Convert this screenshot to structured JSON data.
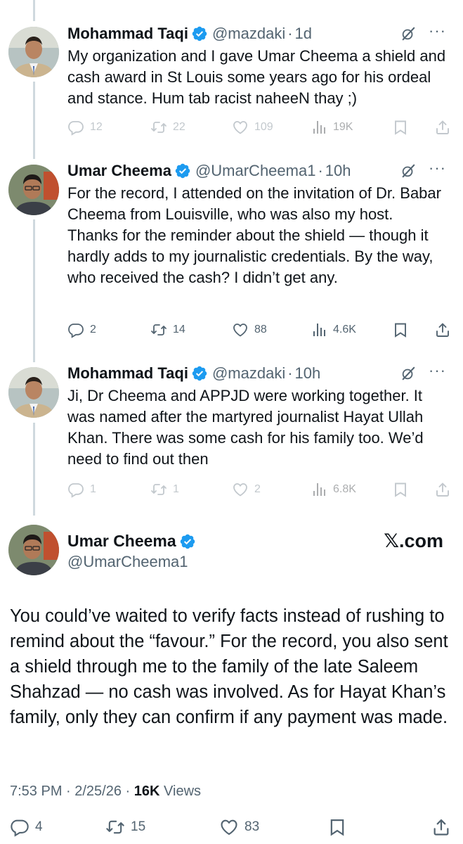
{
  "tweets": [
    {
      "name": "Mohammad Taqi",
      "handle": "@mazdaki",
      "time": "1d",
      "text": "My organization and I gave Umar Cheema a shield and cash award in St Louis some years ago for his ordeal and stance. Hum tab racist naheeN thay ;)",
      "replies": "12",
      "reposts": "22",
      "likes": "109",
      "views": "19K",
      "avatar": "avatar-mohammad-taqi"
    },
    {
      "name": "Umar Cheema",
      "handle": "@UmarCheema1",
      "time": "10h",
      "text": "For the record, I attended on the invitation of Dr. Babar Cheema from Louisville, who was also my host. Thanks for the reminder about the shield — though it hardly adds to my journalistic credentials. By the way, who received the cash? I didn’t get any.",
      "replies": "2",
      "reposts": "14",
      "likes": "88",
      "views": "4.6K",
      "avatar": "avatar-umar-cheema"
    },
    {
      "name": "Mohammad Taqi",
      "handle": "@mazdaki",
      "time": "10h",
      "text": "Ji, Dr Cheema and APPJD were working together. It was named after the martyred journalist Hayat Ullah Khan. There was some cash for his family too. We’d need to find out then",
      "replies": "1",
      "reposts": "1",
      "likes": "2",
      "views": "6.8K",
      "avatar": "avatar-mohammad-taqi"
    }
  ],
  "main_tweet": {
    "name": "Umar Cheema",
    "handle": "@UmarCheema1",
    "source_label": "𝕏.com",
    "text": "You could’ve waited to verify facts instead of rushing to remind about the “favour.” For the record, you also sent a shield through me to the family of the late Saleem Shahzad — no cash was involved. As for Hayat Khan’s family, only they can confirm if any payment was made.",
    "timestamp": "7:53 PM · 2/25/26 · ",
    "views_count": "16K",
    "views_label": " Views",
    "replies": "4",
    "reposts": "15",
    "likes": "83"
  },
  "separator": "·",
  "more_label": "···",
  "colors": {
    "verified": "#1d9bf0",
    "muted": "#536471",
    "text": "#0f1419",
    "thread_line": "#cfd9de"
  }
}
